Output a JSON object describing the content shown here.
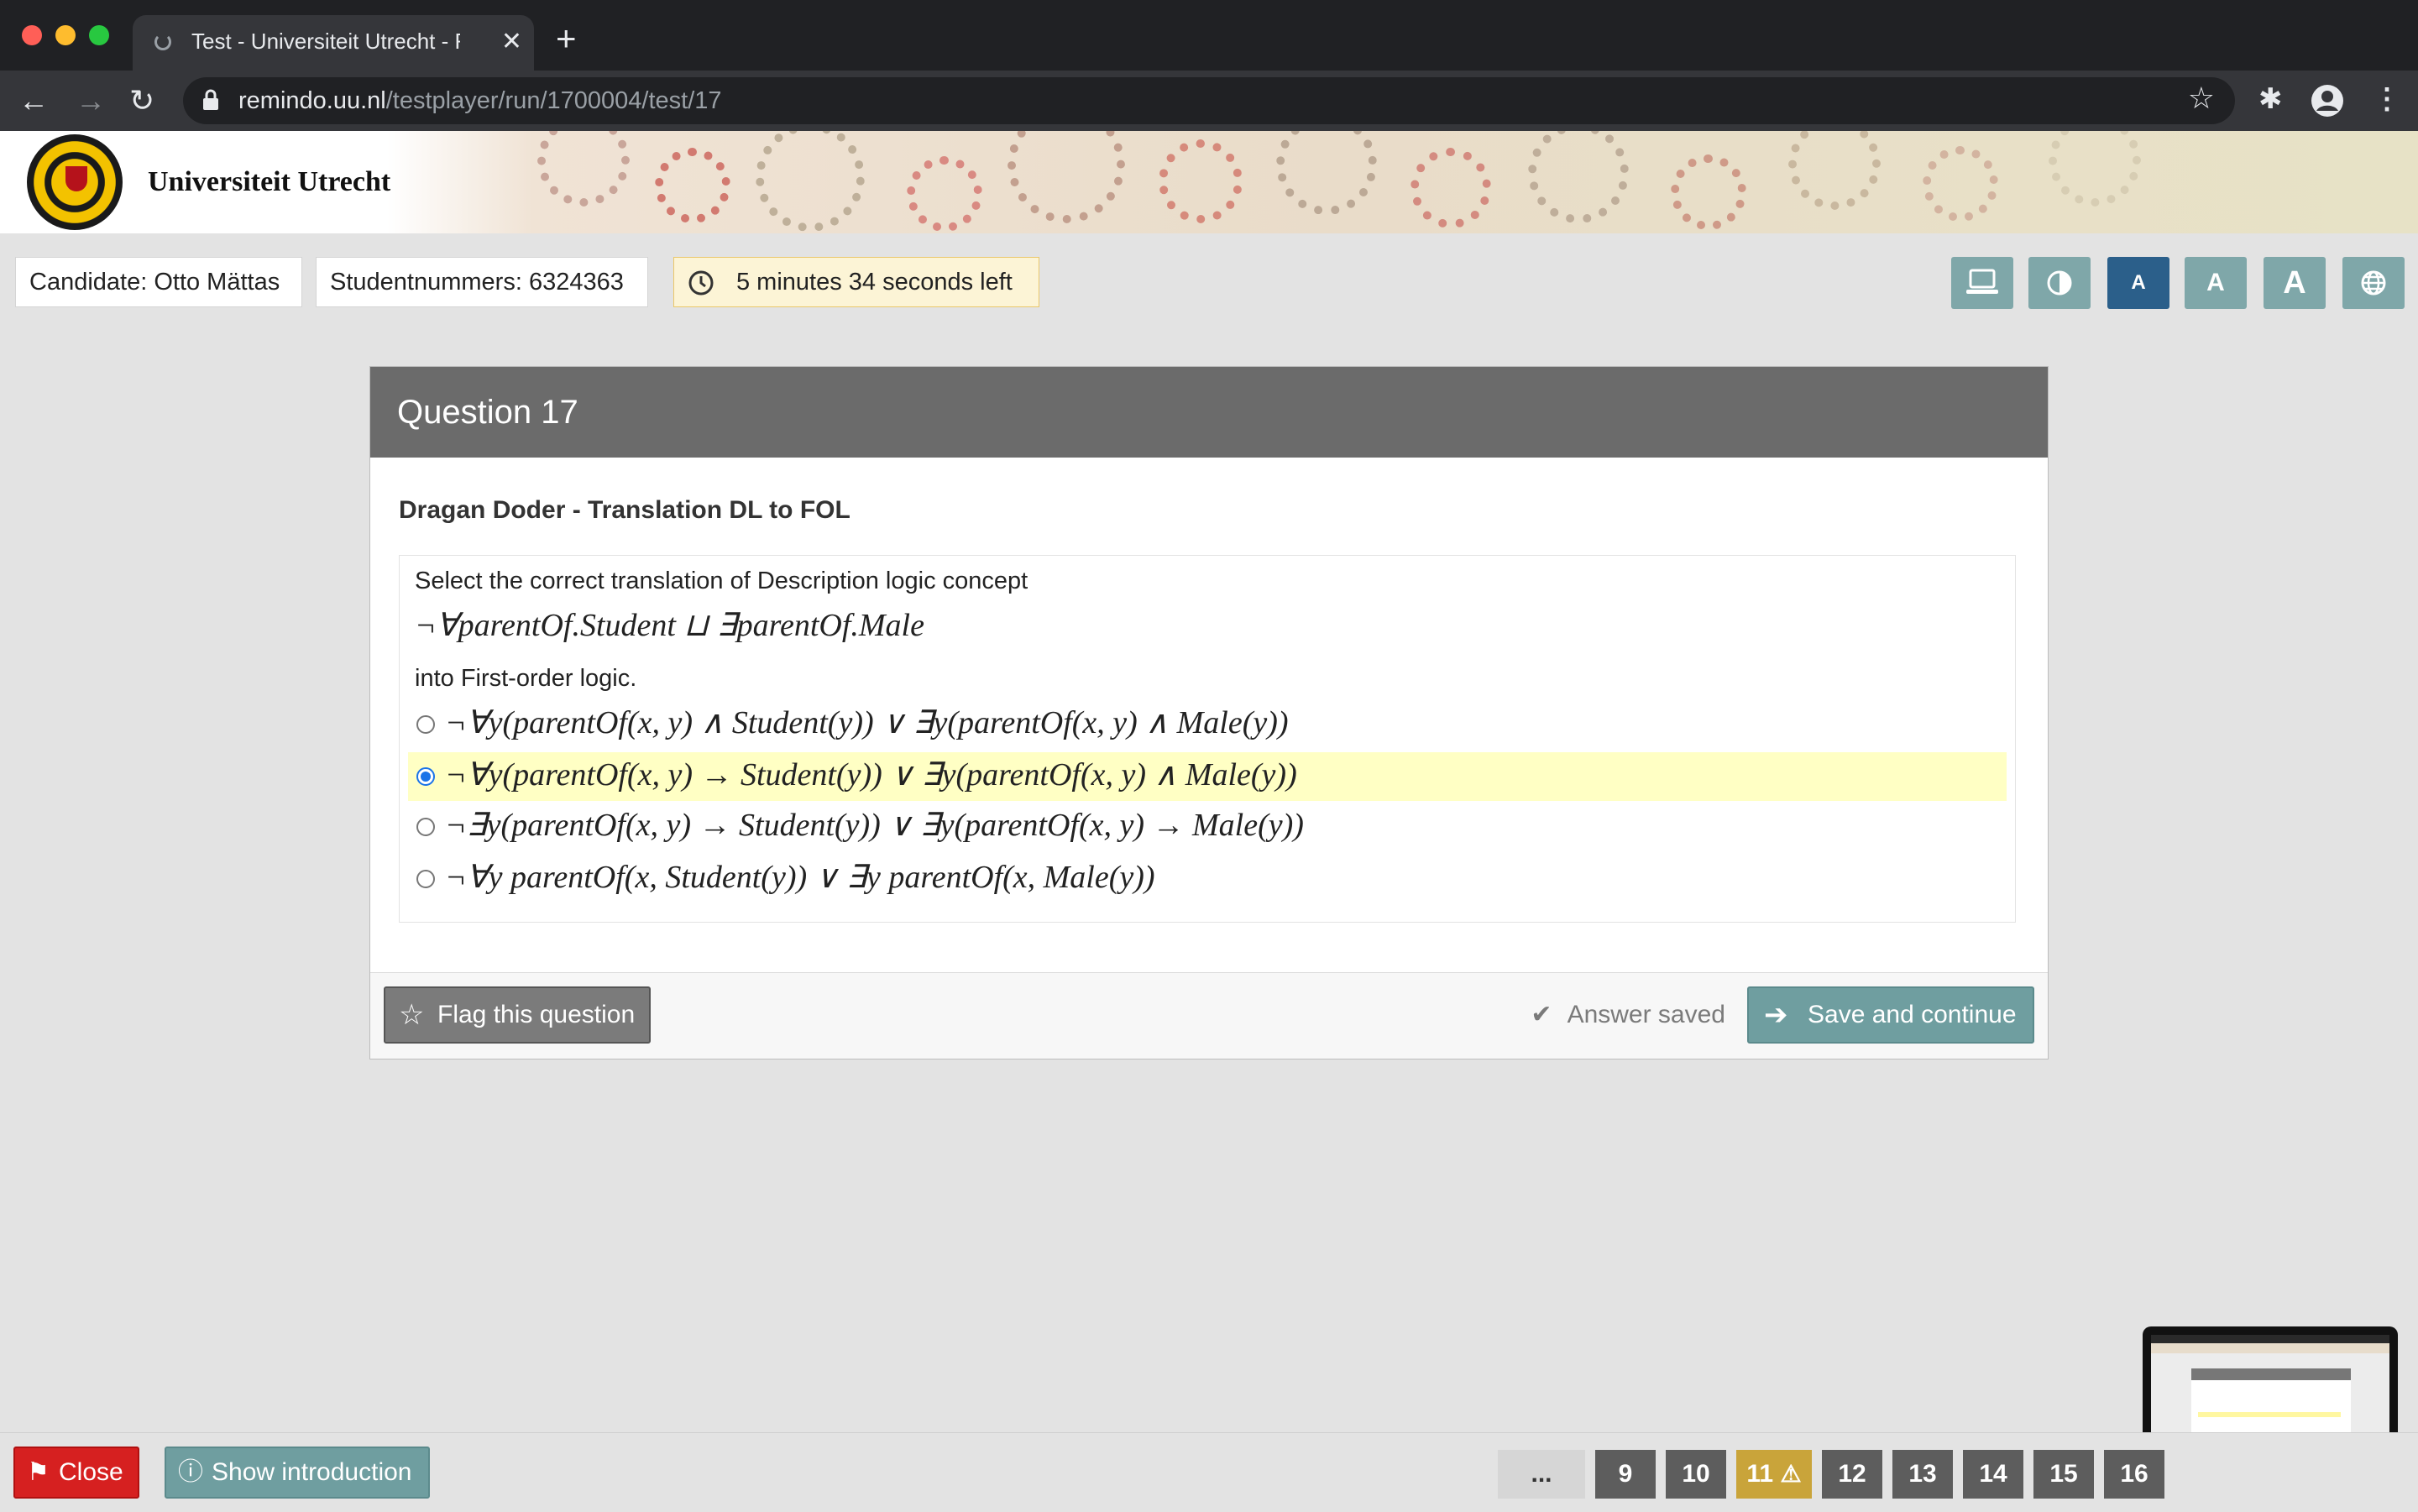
{
  "browser": {
    "tab_title": "Test - Universiteit Utrecht - Re",
    "url_host": "remindo.uu.nl",
    "url_path": "/testplayer/run/1700004/test/17"
  },
  "banner": {
    "university_name": "Universiteit Utrecht"
  },
  "info": {
    "candidate": "Candidate: Otto Mättas",
    "student_number": "Studentnummers: 6324363",
    "timer": "5 minutes 34 seconds left"
  },
  "tools": {
    "font_small": "A",
    "font_medium": "A",
    "font_large": "A"
  },
  "question": {
    "header": "Question 17",
    "title": "Dragan Doder - Translation DL to FOL",
    "prompt": "Select the correct translation of Description logic concept",
    "concept": "¬∀parentOf.Student ⊔ ∃parentOf.Male",
    "into": "into First-order logic.",
    "options": [
      {
        "text": "¬∀y(parentOf(x, y) ∧ Student(y)) ∨ ∃y(parentOf(x, y) ∧ Male(y))",
        "selected": false
      },
      {
        "text": "¬∀y(parentOf(x, y) → Student(y)) ∨ ∃y(parentOf(x, y) ∧ Male(y))",
        "selected": true
      },
      {
        "text": "¬∃y(parentOf(x, y) → Student(y)) ∨ ∃y(parentOf(x, y) → Male(y))",
        "selected": false
      },
      {
        "text": "¬∀y parentOf(x, Student(y)) ∨ ∃y parentOf(x, Male(y))",
        "selected": false
      }
    ]
  },
  "footer": {
    "flag_label": "Flag this question",
    "saved_label": "Answer saved",
    "save_label": "Save and continue"
  },
  "bottom": {
    "close_label": "Close",
    "intro_label": "Show introduction",
    "ellipsis": "...",
    "numbers": [
      "9",
      "10",
      "11",
      "12",
      "13",
      "14",
      "15",
      "16"
    ],
    "flagged_number": "11"
  },
  "colors": {
    "accent_teal": "#6f9ea0",
    "active_tool": "#2b5f8a",
    "close_red": "#d62020",
    "selected_option_bg": "#ffffc4",
    "flagged_badge": "#c9a43a"
  }
}
